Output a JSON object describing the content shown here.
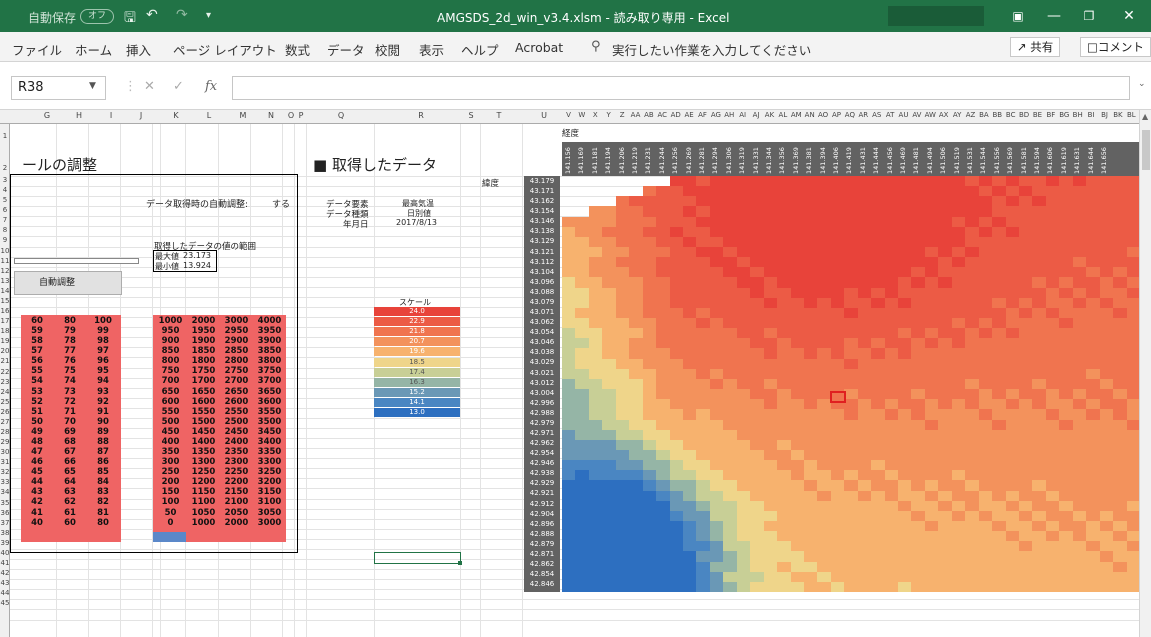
{
  "titlebar": {
    "autosave_label": "自動保存",
    "autosave_state": "オフ",
    "document_title": "AMGSDS_2d_win_v3.4.xlsm  -  読み取り専用  -  Excel",
    "icons": [
      "save-icon",
      "undo-icon",
      "redo-icon",
      "customize-icon",
      "ribbon-display-icon",
      "minimize-icon",
      "restore-icon",
      "close-icon"
    ]
  },
  "ribbon": {
    "tabs": [
      "ファイル",
      "ホーム",
      "挿入",
      "ページ レイアウト",
      "数式",
      "データ",
      "校閲",
      "表示",
      "ヘルプ",
      "Acrobat"
    ],
    "tell_me": "実行したい作業を入力してください",
    "share_label": "共有",
    "comment_label": "コメント"
  },
  "formula_bar": {
    "name_box": "R38",
    "fx_label": "fx"
  },
  "sheet": {
    "columns": [
      "G",
      "H",
      "I",
      "J",
      "K",
      "L",
      "M",
      "N",
      "O",
      "P",
      "Q",
      "R",
      "S",
      "T",
      "U",
      "V",
      "W",
      "X",
      "Y",
      "Z",
      "AA",
      "AB",
      "AC",
      "AD",
      "AE",
      "AF",
      "AG",
      "AH",
      "AI",
      "AJ",
      "AK",
      "AL",
      "AM",
      "AN",
      "AO",
      "AP",
      "AQ",
      "AR",
      "AS",
      "AT",
      "AU",
      "AV",
      "AW",
      "AX",
      "AY",
      "AZ",
      "BA",
      "BB",
      "BC",
      "BD",
      "BE",
      "BF",
      "BG",
      "BH",
      "BI",
      "BJ",
      "BK",
      "BL"
    ],
    "rows": [
      "1",
      "2",
      "3",
      "4",
      "5",
      "6",
      "7",
      "8",
      "9",
      "10",
      "11",
      "12",
      "13",
      "14",
      "15",
      "16",
      "17",
      "18",
      "19",
      "20",
      "21",
      "22",
      "23",
      "24",
      "25",
      "26",
      "27",
      "28",
      "29",
      "30",
      "31",
      "32",
      "33",
      "34",
      "35",
      "36",
      "37",
      "38",
      "39",
      "40",
      "41",
      "42",
      "43",
      "44",
      "45"
    ],
    "section_left_title": "ールの調整",
    "auto_adjust_label": "データ取得時の自動調整:",
    "auto_adjust_value": "する",
    "range_label": "取得したデータの値の範囲",
    "max_label": "最大値",
    "max_value": "23.173",
    "min_label": "最小値",
    "min_value": "13.924",
    "auto_adjust_button": "自動調整",
    "section_right_title": "■ 取得したデータ",
    "element_label": "データ要素",
    "element_value": "最高気温",
    "kind_label": "データ種類",
    "kind_value": "日別値",
    "date_label": "年月日",
    "date_value": "2017/8/13",
    "lat_header": "緯度",
    "lon_header": "経度",
    "scale_title": "スケール",
    "scale": [
      {
        "value": "24.0",
        "color": "#e8433a"
      },
      {
        "value": "22.9",
        "color": "#ec5b45"
      },
      {
        "value": "21.8",
        "color": "#f0744f"
      },
      {
        "value": "20.7",
        "color": "#f3925c"
      },
      {
        "value": "19.6",
        "color": "#f7b26e"
      },
      {
        "value": "18.5",
        "color": "#efd58a"
      },
      {
        "value": "17.4",
        "color": "#c8cf96"
      },
      {
        "value": "16.3",
        "color": "#95b5a6"
      },
      {
        "value": "15.2",
        "color": "#6a98b6"
      },
      {
        "value": "14.1",
        "color": "#4a86c2"
      },
      {
        "value": "13.0",
        "color": "#2d6fc0"
      }
    ],
    "red_table": {
      "col_g": [
        "60",
        "59",
        "58",
        "57",
        "56",
        "55",
        "54",
        "53",
        "52",
        "51",
        "50",
        "49",
        "48",
        "47",
        "46",
        "45",
        "44",
        "43",
        "42",
        "41",
        "40"
      ],
      "col_h": [
        "80",
        "79",
        "78",
        "77",
        "76",
        "75",
        "74",
        "73",
        "72",
        "71",
        "70",
        "69",
        "68",
        "67",
        "66",
        "65",
        "64",
        "63",
        "62",
        "61",
        "60"
      ],
      "col_i": [
        "100",
        "99",
        "98",
        "97",
        "96",
        "95",
        "94",
        "93",
        "92",
        "91",
        "90",
        "89",
        "88",
        "87",
        "86",
        "85",
        "84",
        "83",
        "82",
        "81",
        "80"
      ],
      "col_k": [
        "1000",
        "950",
        "900",
        "850",
        "800",
        "750",
        "700",
        "650",
        "600",
        "550",
        "500",
        "450",
        "400",
        "350",
        "300",
        "250",
        "200",
        "150",
        "100",
        "50",
        "0"
      ],
      "col_l": [
        "2000",
        "1950",
        "1900",
        "1850",
        "1800",
        "1750",
        "1700",
        "1650",
        "1600",
        "1550",
        "1500",
        "1450",
        "1400",
        "1350",
        "1300",
        "1250",
        "1200",
        "1150",
        "1100",
        "1050",
        "1000"
      ],
      "col_m": [
        "3000",
        "2950",
        "2900",
        "2850",
        "2800",
        "2750",
        "2700",
        "2650",
        "2600",
        "2550",
        "2500",
        "2450",
        "2400",
        "2350",
        "2300",
        "2250",
        "2200",
        "2150",
        "2100",
        "2050",
        "2000"
      ],
      "col_n": [
        "4000",
        "3950",
        "3900",
        "3850",
        "3800",
        "3750",
        "3700",
        "3650",
        "3600",
        "3550",
        "3500",
        "3450",
        "3400",
        "3350",
        "3300",
        "3250",
        "3200",
        "3150",
        "3100",
        "3050",
        "3000"
      ]
    },
    "latitudes": [
      "43.179",
      "43.171",
      "43.162",
      "43.154",
      "43.146",
      "43.138",
      "43.129",
      "43.121",
      "43.112",
      "43.104",
      "43.096",
      "43.088",
      "43.079",
      "43.071",
      "43.062",
      "43.054",
      "43.046",
      "43.038",
      "43.029",
      "43.021",
      "43.012",
      "43.004",
      "42.996",
      "42.988",
      "42.979",
      "42.971",
      "42.962",
      "42.954",
      "42.946",
      "42.938",
      "42.929",
      "42.921",
      "42.912",
      "42.904",
      "42.896",
      "42.888",
      "42.879",
      "42.871",
      "42.862",
      "42.854",
      "42.846"
    ],
    "longitudes": [
      "141.156",
      "141.169",
      "141.181",
      "141.194",
      "141.206",
      "141.219",
      "141.231",
      "141.244",
      "141.256",
      "141.269",
      "141.281",
      "141.294",
      "141.306",
      "141.319",
      "141.331",
      "141.344",
      "141.356",
      "141.369",
      "141.381",
      "141.394",
      "141.406",
      "141.419",
      "141.431",
      "141.444",
      "141.456",
      "141.469",
      "141.481",
      "141.494",
      "141.506",
      "141.519",
      "141.531",
      "141.544",
      "141.556",
      "141.569",
      "141.581",
      "141.594",
      "141.606",
      "141.619",
      "141.631",
      "141.644",
      "141.656"
    ]
  }
}
